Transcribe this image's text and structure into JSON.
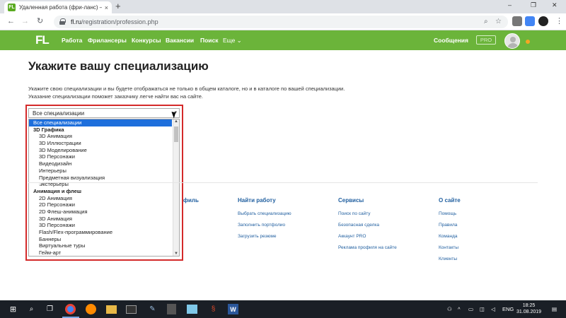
{
  "browser": {
    "tab_title": "Удаленная работа (фри-ланс) –",
    "tab_close": "×",
    "new_tab": "+",
    "win_min": "–",
    "win_max": "❐",
    "win_close": "✕",
    "url_host": "fl.ru",
    "url_path": "/registration/profession.php",
    "star": "☆"
  },
  "site": {
    "logo": "FL",
    "nav": [
      "Работа",
      "Фрилансеры",
      "Конкурсы",
      "Вакансии",
      "Поиск",
      "Еще"
    ],
    "messages": "Сообщения",
    "pro": "PRO",
    "nav_more_chevron": "⌄"
  },
  "page": {
    "title": "Укажите вашу специализацию",
    "desc_line1": "Укажите свою специализации и вы будете отображаться не только в общем каталоге, но и в каталоге по вашей специализации.",
    "desc_line2": "Указание специализации поможет заказчику легче найти вас на сайте."
  },
  "dropdown": {
    "value": "Все специализации",
    "options": [
      {
        "label": "Все специализации",
        "type": "selected"
      },
      {
        "label": "3D Графика",
        "type": "group"
      },
      {
        "label": "3D Анимация",
        "type": "item"
      },
      {
        "label": "3D Иллюстрации",
        "type": "item"
      },
      {
        "label": "3D Моделирование",
        "type": "item"
      },
      {
        "label": "3D Персонажи",
        "type": "item"
      },
      {
        "label": "Видеодизайн",
        "type": "item"
      },
      {
        "label": "Интерьеры",
        "type": "item"
      },
      {
        "label": "Предметная визуализация",
        "type": "item"
      },
      {
        "label": "Экстерьеры",
        "type": "item"
      },
      {
        "label": "Анимация и флеш",
        "type": "group"
      },
      {
        "label": "2D Анимация",
        "type": "item"
      },
      {
        "label": "2D Персонажи",
        "type": "item"
      },
      {
        "label": "2D Флеш-анимация",
        "type": "item"
      },
      {
        "label": "3D Анимация",
        "type": "item"
      },
      {
        "label": "3D Персонажи",
        "type": "item"
      },
      {
        "label": "Flash/Flex-программирование",
        "type": "item"
      },
      {
        "label": "Баннеры",
        "type": "item"
      },
      {
        "label": "Виртуальные туры",
        "type": "item"
      },
      {
        "label": "Гейм-арт",
        "type": "item"
      }
    ]
  },
  "footer": {
    "col_partial": "филь",
    "find_work": {
      "title": "Найти работу",
      "links": [
        "Выбрать специализацию",
        "Заполнить портфолио",
        "Загрузить резюме"
      ]
    },
    "services": {
      "title": "Сервисы",
      "links": [
        "Поиск по сайту",
        "Безопасная сделка",
        "Аккаунт PRO",
        "Реклама профиля на сайте"
      ]
    },
    "about": {
      "title": "О сайте",
      "links": [
        "Помощь",
        "Правила",
        "Команда",
        "Контакты",
        "Клиенты"
      ]
    }
  },
  "taskbar": {
    "lang": "ENG",
    "time": "18:25",
    "date": "31.08.2019"
  },
  "colors": {
    "brand_green": "#6bb43a",
    "link_blue": "#1f5e9f",
    "highlight_red": "#d42a2a",
    "selected_blue": "#1e6fdc"
  }
}
